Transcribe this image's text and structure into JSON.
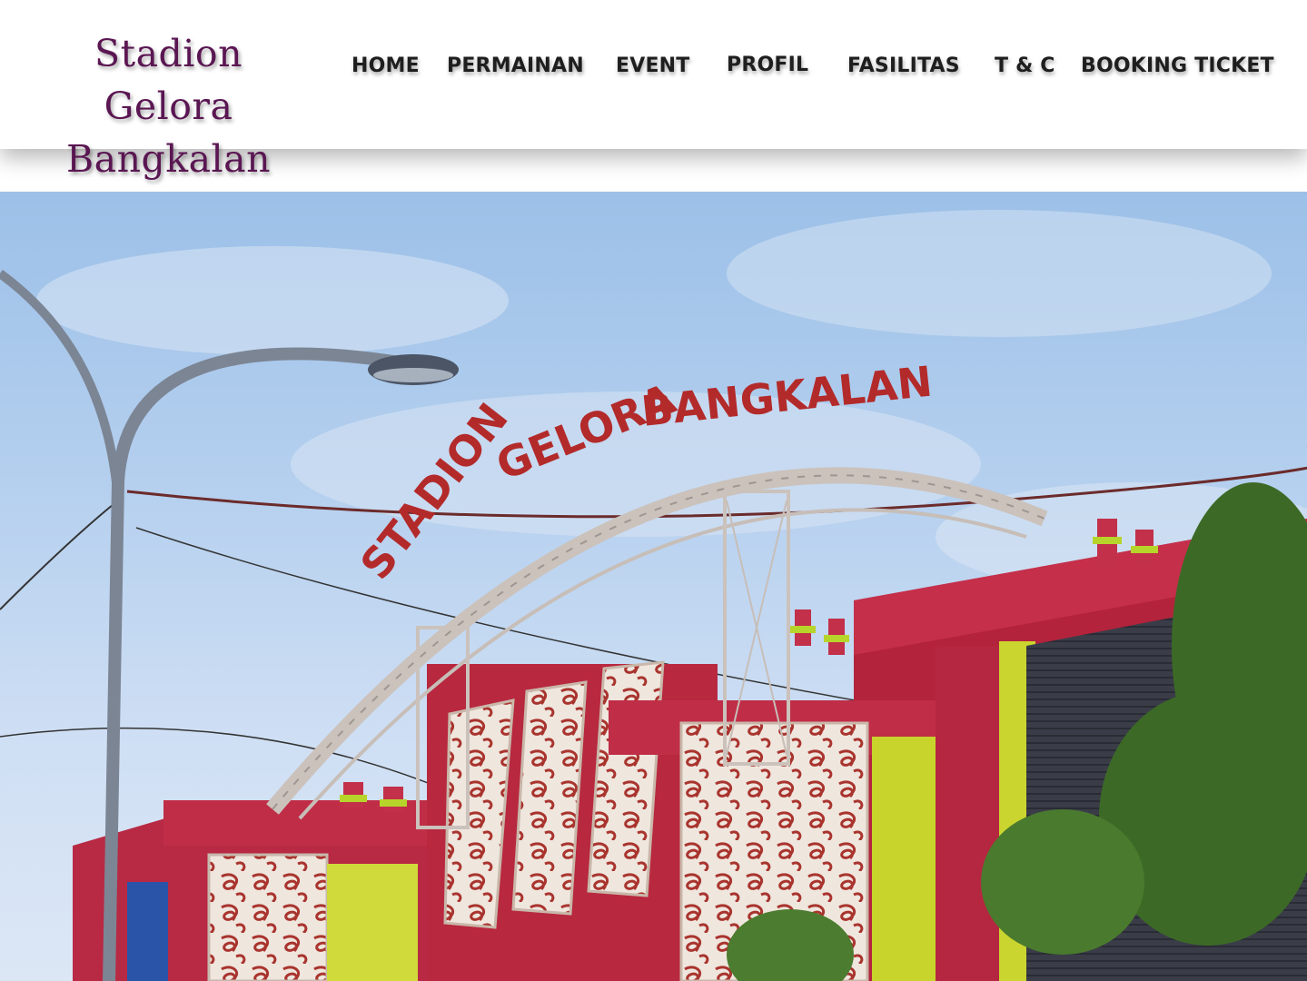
{
  "header": {
    "brand_line1": "Stadion Gelora",
    "brand_line2": "Bangkalan"
  },
  "nav": {
    "items": [
      {
        "label": "HOME"
      },
      {
        "label": "PERMAINAN"
      },
      {
        "label": "EVENT"
      },
      {
        "label": "PROFIL"
      },
      {
        "label": "FASILITAS"
      },
      {
        "label": "T & C"
      },
      {
        "label": "BOOKING TICKET"
      }
    ]
  },
  "hero": {
    "sign_word1": "STADION",
    "sign_word2": "GELORA",
    "sign_word3": "BANGKALAN"
  },
  "colors": {
    "brand": "#5a1652",
    "nav_text": "#1e1e1e",
    "building_red": "#c42a45",
    "building_yellow": "#c8d82a",
    "sign_text": "#b32a2a"
  }
}
